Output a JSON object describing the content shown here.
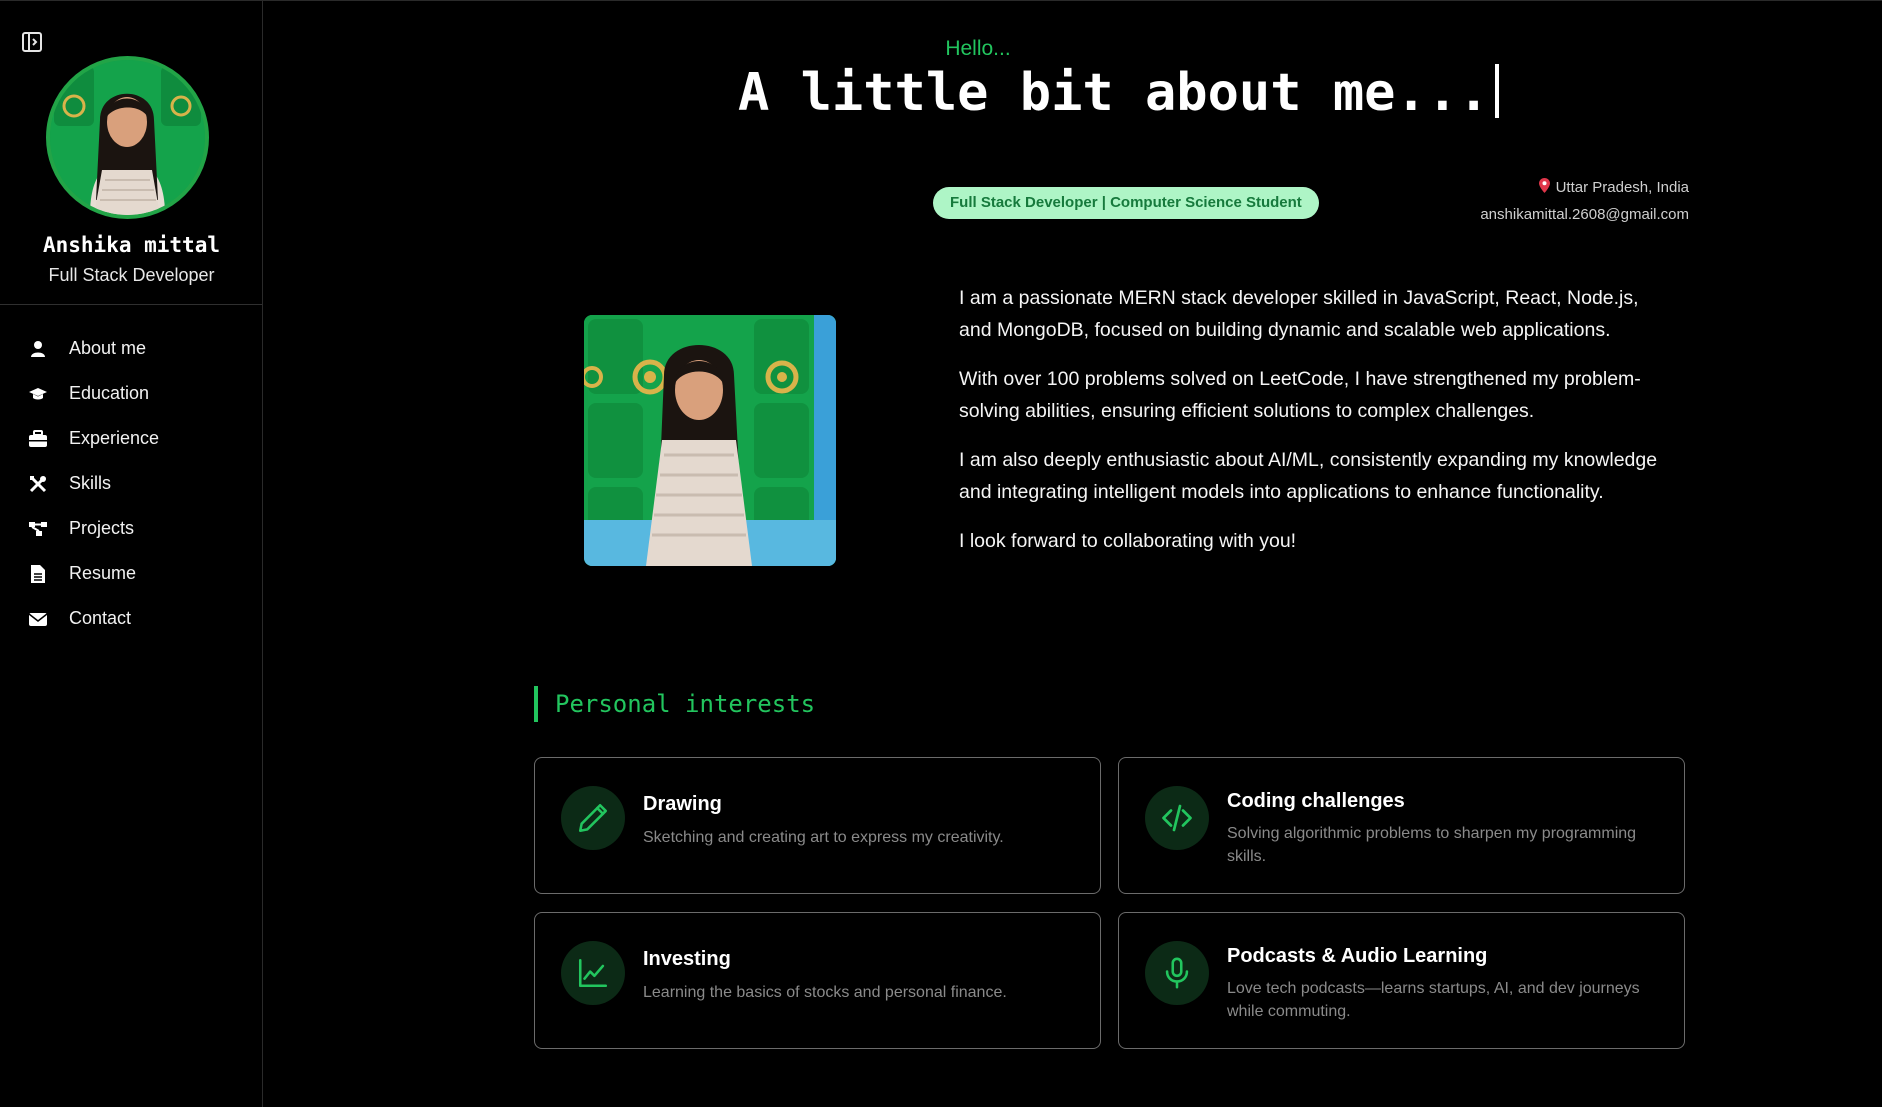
{
  "profile": {
    "name": "Anshika mittal",
    "role": "Full Stack Developer"
  },
  "nav": {
    "items": [
      {
        "label": "About me",
        "icon": "user-icon"
      },
      {
        "label": "Education",
        "icon": "graduation-cap-icon"
      },
      {
        "label": "Experience",
        "icon": "briefcase-icon"
      },
      {
        "label": "Skills",
        "icon": "tools-icon"
      },
      {
        "label": "Projects",
        "icon": "project-diagram-icon"
      },
      {
        "label": "Resume",
        "icon": "file-icon"
      },
      {
        "label": "Contact",
        "icon": "envelope-icon"
      }
    ]
  },
  "header": {
    "greeting": "Hello...",
    "headline": "A little bit about me..."
  },
  "intro": {
    "role_badge": "Full Stack Developer | Computer Science Student",
    "location": "Uttar Pradesh, India",
    "email": "anshikamittal.2608@gmail.com"
  },
  "bio": {
    "paragraphs": [
      "I am a passionate MERN stack developer skilled in JavaScript, React, Node.js, and MongoDB, focused on building dynamic and scalable web applications.",
      "With over 100 problems solved on LeetCode, I have strengthened my problem-solving abilities, ensuring efficient solutions to complex challenges.",
      "I am also deeply enthusiastic about AI/ML, consistently expanding my knowledge and integrating intelligent models into applications to enhance functionality.",
      "I look forward to collaborating with you!"
    ]
  },
  "interests": {
    "title": "Personal interests",
    "items": [
      {
        "title": "Drawing",
        "desc": "Sketching and creating art to express my creativity.",
        "icon": "pencil-icon"
      },
      {
        "title": "Coding challenges",
        "desc": "Solving algorithmic problems to sharpen my programming skills.",
        "icon": "code-icon"
      },
      {
        "title": "Investing",
        "desc": "Learning the basics of stocks and personal finance.",
        "icon": "chart-line-icon"
      },
      {
        "title": "Podcasts & Audio Learning",
        "desc": "Love tech podcasts—learns startups, AI, and dev journeys while commuting.",
        "icon": "microphone-icon"
      }
    ]
  },
  "colors": {
    "accent": "#22c55e",
    "background": "#000000",
    "badge_bg": "#aef5c6",
    "badge_text": "#167a3c"
  }
}
